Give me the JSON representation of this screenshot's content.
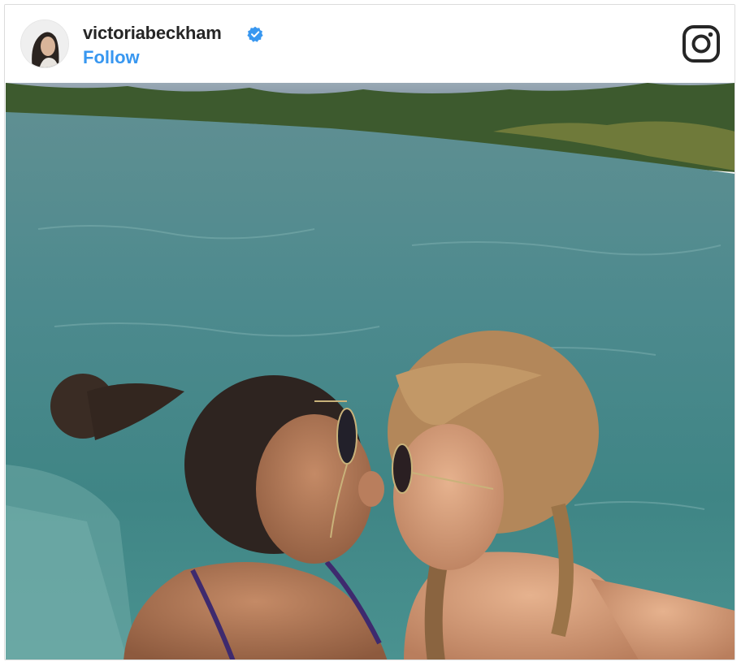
{
  "post": {
    "username": "victoriabeckham",
    "follow_label": "Follow",
    "verified": true,
    "avatar_icon": "profile-avatar",
    "platform_icon": "instagram-icon",
    "photo_icon": "post-photo"
  },
  "colors": {
    "follow": "#3897f0",
    "verified": "#3897f0",
    "username": "#262626",
    "border": "#dcdcdc"
  }
}
